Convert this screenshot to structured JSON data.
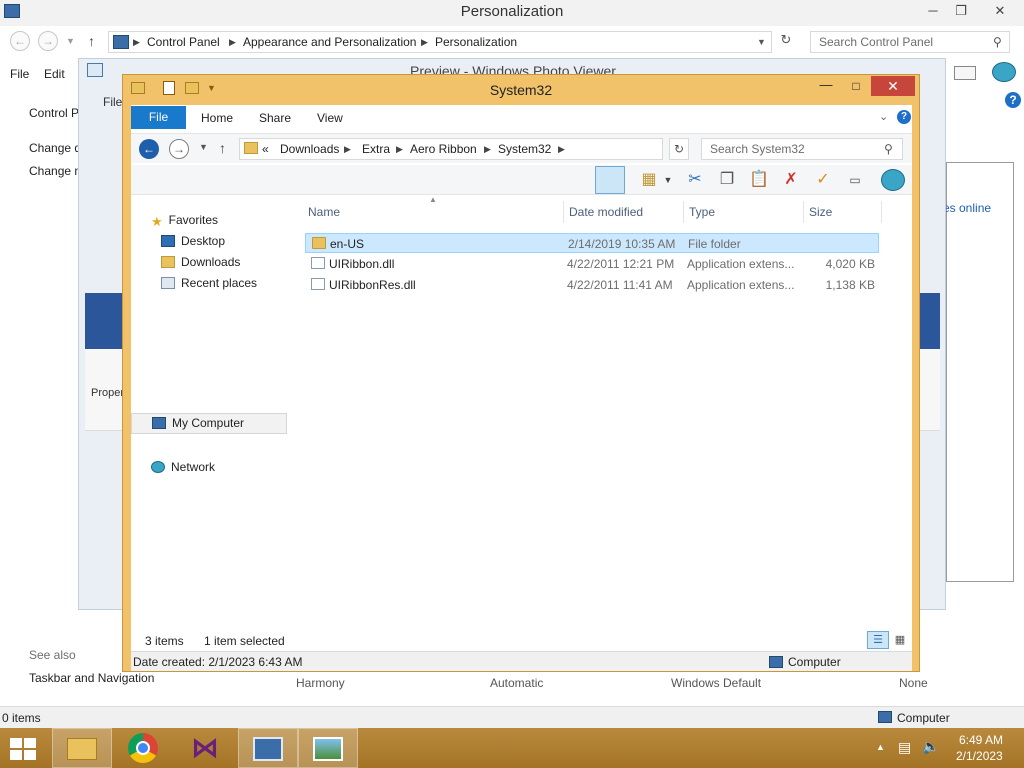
{
  "personalization": {
    "title": "Personalization",
    "controls": {
      "minimize": "─",
      "maximize": "❐",
      "close": "✕"
    },
    "breadcrumb": [
      "Control Panel",
      "Appearance and Personalization",
      "Personalization"
    ],
    "search_placeholder": "Search Control Panel",
    "menu": [
      "File",
      "Edit"
    ],
    "left_links": [
      "Control P",
      "Change d",
      "Change m"
    ],
    "see_also": "See also",
    "taskbar_nav": "Taskbar and Navigation",
    "theme_labels": [
      "Harmony",
      "Automatic",
      "Windows Default",
      "None"
    ],
    "status_items": "0 items",
    "status_location": "Computer",
    "right_link": "es online"
  },
  "photo_viewer": {
    "title": "Preview - Windows Photo Viewer",
    "menu_partial": "File",
    "properties_partial": "Proper"
  },
  "explorer": {
    "title": "System32",
    "tabs": {
      "file": "File",
      "home": "Home",
      "share": "Share",
      "view": "View"
    },
    "breadcrumb": {
      "overflow": "«",
      "items": [
        "Downloads",
        "Extra",
        "Aero Ribbon",
        "System32"
      ]
    },
    "search_placeholder": "Search System32",
    "nav": {
      "favorites": "Favorites",
      "desktop": "Desktop",
      "downloads": "Downloads",
      "recent": "Recent places",
      "computer": "My Computer",
      "network": "Network"
    },
    "columns": {
      "name": "Name",
      "date": "Date modified",
      "type": "Type",
      "size": "Size"
    },
    "files": [
      {
        "name": "en-US",
        "date": "2/14/2019 10:35 AM",
        "type": "File folder",
        "size": ""
      },
      {
        "name": "UIRibbon.dll",
        "date": "4/22/2011 12:21 PM",
        "type": "Application extens...",
        "size": "4,020 KB"
      },
      {
        "name": "UIRibbonRes.dll",
        "date": "4/22/2011 11:41 AM",
        "type": "Application extens...",
        "size": "1,138 KB"
      }
    ],
    "status": {
      "count": "3 items",
      "selected": "1 item selected"
    },
    "details": {
      "created": "Date created: 2/1/2023 6:43 AM",
      "location": "Computer"
    },
    "colors": {
      "frame": "#f2c26b",
      "file_tab": "#1979ca",
      "selection": "#cce8ff",
      "close": "#c7463c"
    }
  },
  "taskbar": {
    "time": "6:49 AM",
    "date": "2/1/2023",
    "apps": [
      "file-explorer",
      "chrome",
      "visual-studio",
      "control-panel",
      "photo-viewer"
    ]
  }
}
